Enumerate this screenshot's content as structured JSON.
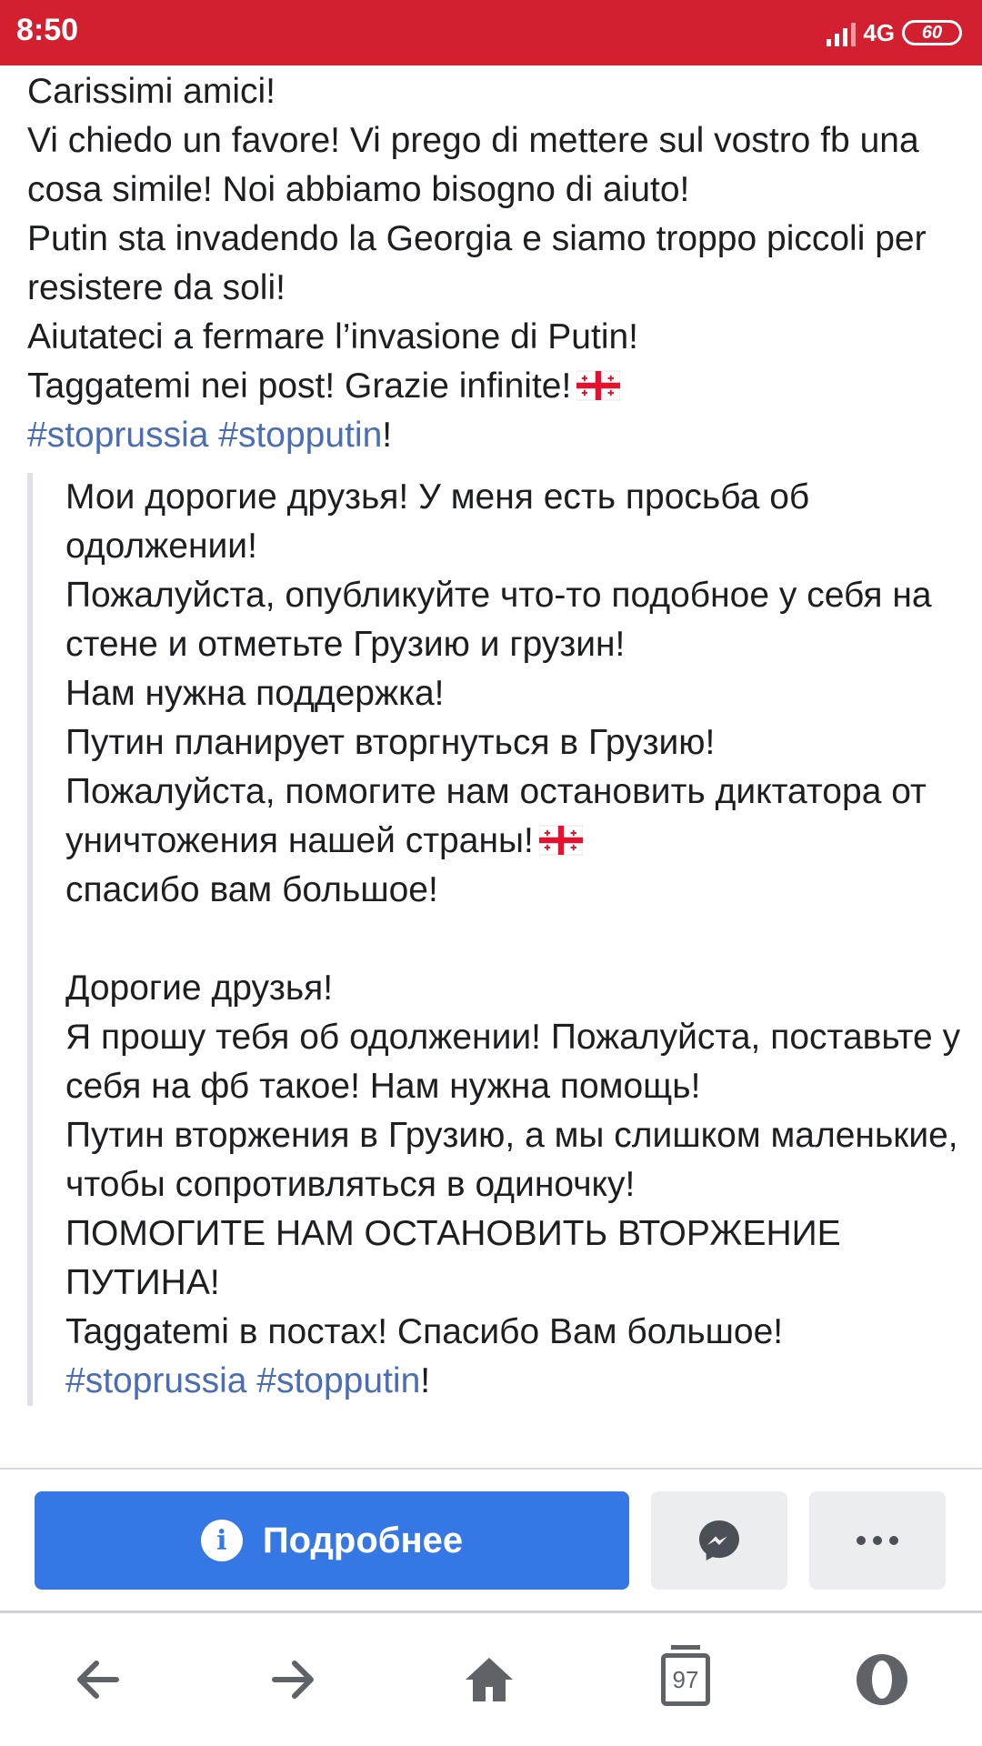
{
  "status_bar": {
    "time": "8:50",
    "network": "4G",
    "battery": "60"
  },
  "post": {
    "paragraphs_it": [
      "Carissimi amici!",
      "Vi chiedo un favore! Vi prego di mettere sul vostro fb una cosa simile! Noi abbiamo bisogno di aiuto!",
      "Putin sta invadendo la Georgia e siamo troppo piccoli per resistere da soli!",
      "Aiutateci a fermare l’invasione di Putin!",
      "Taggatemi nei post! Grazie infinite!"
    ],
    "hashtags_it": [
      "#stoprussia",
      "#stopputin"
    ],
    "hashtag_suffix": "!",
    "quote_ru_1": [
      "Мои дорогие друзья! У меня есть просьба об одолжении!",
      "Пожалуйста, опубликуйте что-то подобное у себя на стене и отметьте Грузию и грузин!",
      "Нам нужна поддержка!",
      "Путин планирует вторгнуться в Грузию!",
      "Пожалуйста, помогите нам остановить диктатора от уничтожения нашей страны!",
      "спасибо вам большое!"
    ],
    "quote_ru_2": [
      "Дорогие друзья!",
      "Я прошу тебя об одолжении! Пожалуйста, поставьте у себя на фб такое! Нам нужна помощь!",
      "Путин вторжения в Грузию, а мы слишком маленькие, чтобы сопротивляться в одиночку!",
      "ПОМОГИТЕ НАМ ОСТАНОВИТЬ ВТОРЖЕНИЕ ПУТИНА!",
      "Taggatemi в постах! Спасибо Вам большое!"
    ],
    "hashtags_ru": [
      "#stoprussia",
      "#stopputin"
    ]
  },
  "actions": {
    "primary_label": "Подробнее",
    "primary_icon": "info-icon",
    "messenger_icon": "messenger-icon",
    "more_icon": "more-dots-icon"
  },
  "browser_nav": {
    "tabs_count": "97",
    "icons": [
      "back-arrow-icon",
      "forward-arrow-icon",
      "home-icon",
      "tabs-icon",
      "opera-icon"
    ]
  },
  "colors": {
    "status_bar": "#d32031",
    "primary_button": "#3578e5",
    "hashtag": "#4b6db3"
  }
}
